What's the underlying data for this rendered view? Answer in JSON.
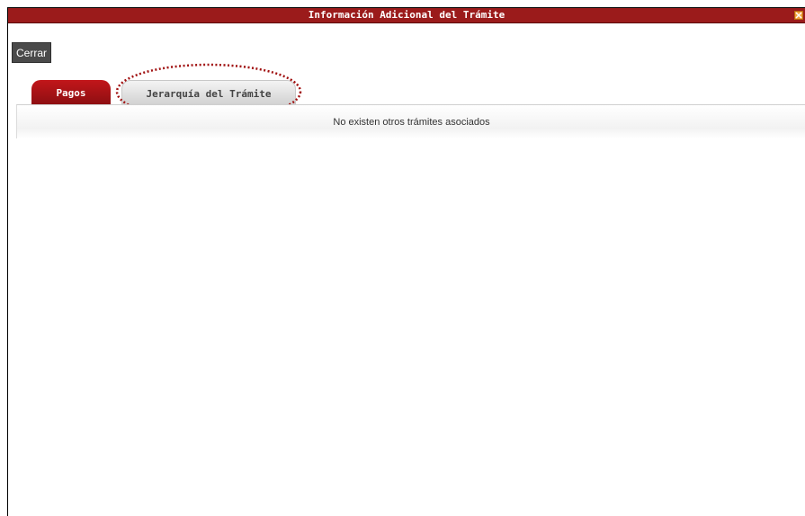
{
  "window": {
    "title": "Información Adicional del Trámite",
    "close_icon": "close-icon"
  },
  "toolbar": {
    "close_label": "Cerrar"
  },
  "tabs": [
    {
      "label": "Pagos",
      "active": true
    },
    {
      "label": "Jerarquía del Trámite",
      "active": false
    }
  ],
  "content": {
    "message": "No existen otros trámites asociados"
  },
  "colors": {
    "title_bar": "#9b1b1b",
    "active_tab": "#b01418",
    "annotation": "#a01010"
  }
}
